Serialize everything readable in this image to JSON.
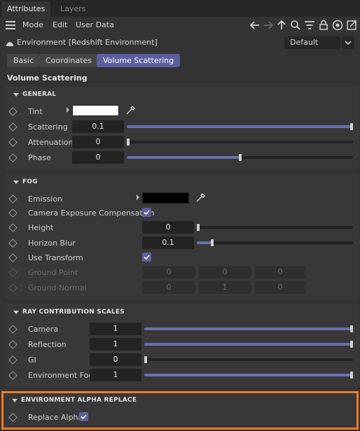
{
  "tabs": [
    {
      "label": "Attributes",
      "active": true
    },
    {
      "label": "Layers",
      "active": false
    }
  ],
  "menu": [
    "Mode",
    "Edit",
    "User Data"
  ],
  "toolbar_icons": [
    "arrow-left-icon",
    "arrow-right-icon",
    "arrow-up-icon",
    "search-icon",
    "filter-icon",
    "lock-icon",
    "target-icon",
    "new-window-icon"
  ],
  "object": {
    "title": "Environment [Redshift Environment]",
    "preset": "Default"
  },
  "page_tabs": [
    {
      "label": "Basic",
      "selected": false
    },
    {
      "label": "Coordinates",
      "selected": false
    },
    {
      "label": "Volume Scattering",
      "selected": true
    }
  ],
  "section_title": "Volume Scattering",
  "general": {
    "header": "GENERAL",
    "tint_label": "Tint",
    "tint_color": "#ffffff",
    "rows": [
      {
        "label": "Scattering",
        "value": "0.1",
        "fraction": 1.0
      },
      {
        "label": "Attenuation",
        "value": "0",
        "fraction": 0.0
      },
      {
        "label": "Phase",
        "value": "0",
        "fraction": 0.5
      }
    ]
  },
  "fog": {
    "header": "FOG",
    "emission_label": "Emission",
    "emission_color": "#000000",
    "camera_exposure_label": "Camera Exposure Compensation",
    "camera_exposure_checked": true,
    "height_label": "Height",
    "height_value": "0",
    "height_fraction": 0.0,
    "horizon_label": "Horizon Blur",
    "horizon_value": "0.1",
    "horizon_fraction": 0.1,
    "use_transform_label": "Use Transform",
    "use_transform_checked": true,
    "ground_point_label": "Ground Point",
    "ground_point": [
      "0",
      "0",
      "0"
    ],
    "ground_normal_label": "Ground Normal",
    "ground_normal": [
      "0",
      "1",
      "0"
    ]
  },
  "ray": {
    "header": "RAY CONTRIBUTION SCALES",
    "rows": [
      {
        "label": "Camera",
        "value": "1",
        "fraction": 1.0
      },
      {
        "label": "Reflection",
        "value": "1",
        "fraction": 1.0
      },
      {
        "label": "GI",
        "value": "0",
        "fraction": 0.0
      },
      {
        "label": "Environment Fog",
        "value": "1",
        "fraction": 1.0
      }
    ]
  },
  "alpha": {
    "header": "ENVIRONMENT ALPHA REPLACE",
    "replace_label": "Replace Alpha",
    "replace_checked": true
  },
  "colors": {
    "accent": "#5b5f9d",
    "slider_fill": "#6b6fb0",
    "highlight": "#f07d23"
  }
}
